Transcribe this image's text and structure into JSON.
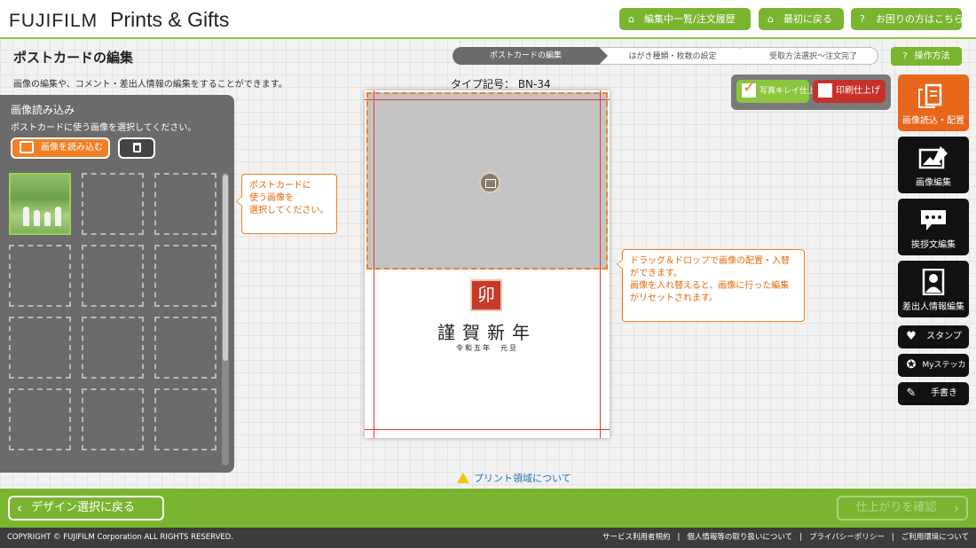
{
  "header": {
    "brand": "FUJIFILM",
    "product": "Prints & Gifts",
    "buttons": [
      {
        "label": "編集中一覧/注文履歴",
        "icon": "home-icon"
      },
      {
        "label": "最初に戻る",
        "icon": "home-icon"
      },
      {
        "label": "お困りの方はこちら",
        "icon": "question-icon"
      }
    ]
  },
  "page": {
    "title": "ポストカードの編集",
    "description": "画像の編集や、コメント・差出人情報の編集をすることができます。",
    "type_code": "タイプ記号： BN-34"
  },
  "steps": [
    "ポストカードの編集",
    "はがき種類・枚数の設定",
    "受取方法選択〜注文完了"
  ],
  "help_button": "操作方法",
  "left_panel": {
    "title": "画像読み込み",
    "subtitle": "ポストカードに使う画像を選択してください。",
    "load_button": "画像を読み込む",
    "delete_icon": "trash-icon"
  },
  "callouts": {
    "select_image": "ポストカードに\n使う画像を\n選択してください。",
    "drag_drop": "ドラッグ＆ドロップで画像の配置・入替ができます。\n画像を入れ替えると、画像に行った編集がリセットされます。"
  },
  "card": {
    "stamp_char": "卯",
    "greeting": "謹賀新年",
    "date_line": "令和五年　元旦"
  },
  "finish_options": [
    {
      "label": "写真キレイ仕上げ",
      "checked": true
    },
    {
      "label": "印刷仕上げ",
      "checked": false
    }
  ],
  "right_tools": [
    {
      "label": "画像読込・配置",
      "icon": "image-load-icon",
      "active": true
    },
    {
      "label": "画像編集",
      "icon": "image-edit-icon",
      "active": false
    },
    {
      "label": "挨拶文編集",
      "icon": "speech-bubble-icon",
      "active": false
    },
    {
      "label": "差出人情報編集",
      "icon": "person-icon",
      "active": false
    },
    {
      "label": "スタンプ",
      "icon": "stamp-icon",
      "active": false
    },
    {
      "label": "Myステッカー",
      "icon": "sticker-icon",
      "active": false
    },
    {
      "label": "手書き",
      "icon": "pen-icon",
      "active": false
    }
  ],
  "print_area_link": "プリント領域について",
  "bottom": {
    "back_label": "デザイン選択に戻る",
    "confirm_label": "仕上がりを確認"
  },
  "footer": {
    "copyright": "COPYRIGHT © FUJIFILM Corporation ALL RIGHTS RESERVED.",
    "links": [
      "サービス利用者規約",
      "個人情報等の取り扱いについて",
      "プライバシーポリシー",
      "ご利用環境について"
    ]
  },
  "colors": {
    "brand_green": "#7ab530",
    "accent_orange": "#f08026",
    "dark_panel": "#6b6b6b",
    "print_red": "#c6322a"
  }
}
